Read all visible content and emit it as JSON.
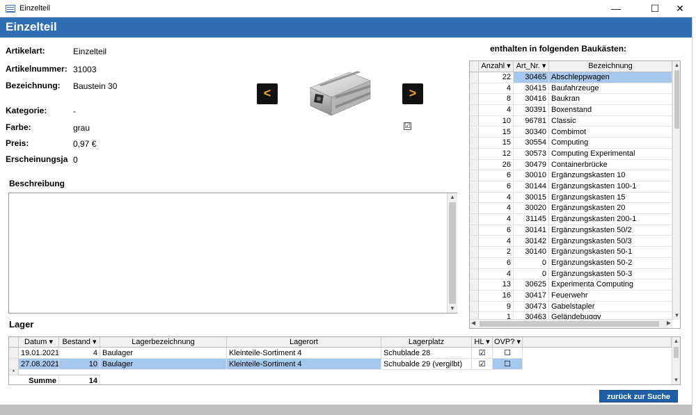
{
  "window": {
    "title": "Einzelteil",
    "minimize": "—",
    "maximize": "☐",
    "close": "✕"
  },
  "header": {
    "title": "Einzelteil"
  },
  "fields": {
    "artikelart": {
      "label": "Artikelart:",
      "value": "Einzelteil"
    },
    "artikelnummer": {
      "label": "Artikelnummer:",
      "value": "31003"
    },
    "bezeichnung": {
      "label": "Bezeichnung:",
      "value": "Baustein 30"
    },
    "kategorie": {
      "label": "Kategorie:",
      "value": "-"
    },
    "farbe": {
      "label": "Farbe:",
      "value": "grau"
    },
    "preis": {
      "label": "Preis:",
      "value": "0,97 €"
    },
    "erscheinungsjahr": {
      "label": "Erscheinungsjahı",
      "value": "0"
    }
  },
  "nav": {
    "prev": "<",
    "next": ">"
  },
  "image_checkbox": "☑",
  "beschreibung": {
    "label": "Beschreibung",
    "value": ""
  },
  "baukaesten": {
    "title": "enthalten in folgenden Baukästen:",
    "columns": [
      "Anzahl",
      "Art_Nr.",
      "Bezeichnung"
    ],
    "rows": [
      [
        "22",
        "30465",
        "Abschleppwagen"
      ],
      [
        "4",
        "30415",
        "Baufahrzeuge"
      ],
      [
        "8",
        "30416",
        "Baukran"
      ],
      [
        "4",
        "30391",
        "Boxenstand"
      ],
      [
        "10",
        "96781",
        "Classic"
      ],
      [
        "15",
        "30340",
        "Combimot"
      ],
      [
        "15",
        "30554",
        "Computing"
      ],
      [
        "12",
        "30573",
        "Computing Experimental"
      ],
      [
        "26",
        "30479",
        "Containerbrücke"
      ],
      [
        "6",
        "30010",
        "Ergänzungskasten 10"
      ],
      [
        "6",
        "30144",
        "Ergänzungskasten 100-1"
      ],
      [
        "4",
        "30015",
        "Ergänzungskasten 15"
      ],
      [
        "4",
        "30020",
        "Ergänzungskasten 20"
      ],
      [
        "4",
        "31145",
        "Ergänzungskasten 200-1"
      ],
      [
        "6",
        "30141",
        "Ergänzungskasten 50/2"
      ],
      [
        "4",
        "30142",
        "Ergänzungskasten 50/3"
      ],
      [
        "2",
        "30140",
        "Ergänzungskasten 50-1"
      ],
      [
        "6",
        "0",
        "Ergänzungskasten 50-2"
      ],
      [
        "4",
        "0",
        "Ergänzungskasten 50-3"
      ],
      [
        "13",
        "30625",
        "Experimenta Computing"
      ],
      [
        "16",
        "30417",
        "Feuerwehr"
      ],
      [
        "9",
        "30473",
        "Gabelstapler"
      ],
      [
        "1",
        "30463",
        "Geländebuggy"
      ]
    ]
  },
  "lager": {
    "title": "Lager",
    "columns": [
      "Datum",
      "Bestand",
      "Lagerbezeichnung",
      "Lagerort",
      "Lagerplatz",
      "HL",
      "OVP?"
    ],
    "rows": [
      {
        "datum": "19.01.2021",
        "bestand": "4",
        "lagerbezeichnung": "Baulager",
        "lagerort": "Kleinteile-Sortiment 4",
        "lagerplatz": "Schublade 28",
        "hl": "☑",
        "ovp": "☐"
      },
      {
        "datum": "27.08.2021",
        "bestand": "10",
        "lagerbezeichnung": "Baulager",
        "lagerort": "Kleinteile-Sortiment 4",
        "lagerplatz": "Schubalde 29 (vergilbt)",
        "hl": "☑",
        "ovp": "☐"
      }
    ],
    "sum_label": "Summe",
    "sum_value": "14"
  },
  "buttons": {
    "back": "zurück zur Suche"
  },
  "colors": {
    "header": "#2f6eb5",
    "selection": "#a6c8ec",
    "nav_arrow": "#f0a020"
  }
}
